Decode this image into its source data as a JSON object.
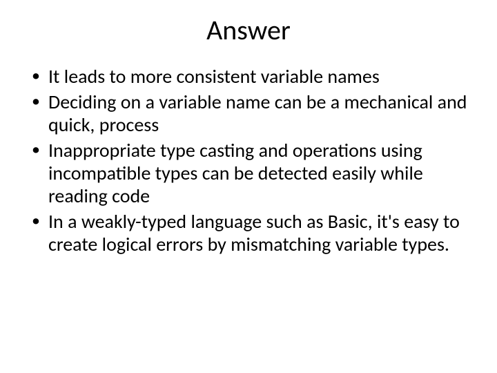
{
  "slide": {
    "title": "Answer",
    "bullets": [
      "It leads to more consistent variable names",
      "Deciding on a variable name can be a mechanical and quick, process",
      "Inappropriate type casting and operations using incompatible types can be detected easily while reading code",
      "In a weakly-typed language such as Basic, it's easy to create logical errors by mismatching variable types."
    ]
  }
}
